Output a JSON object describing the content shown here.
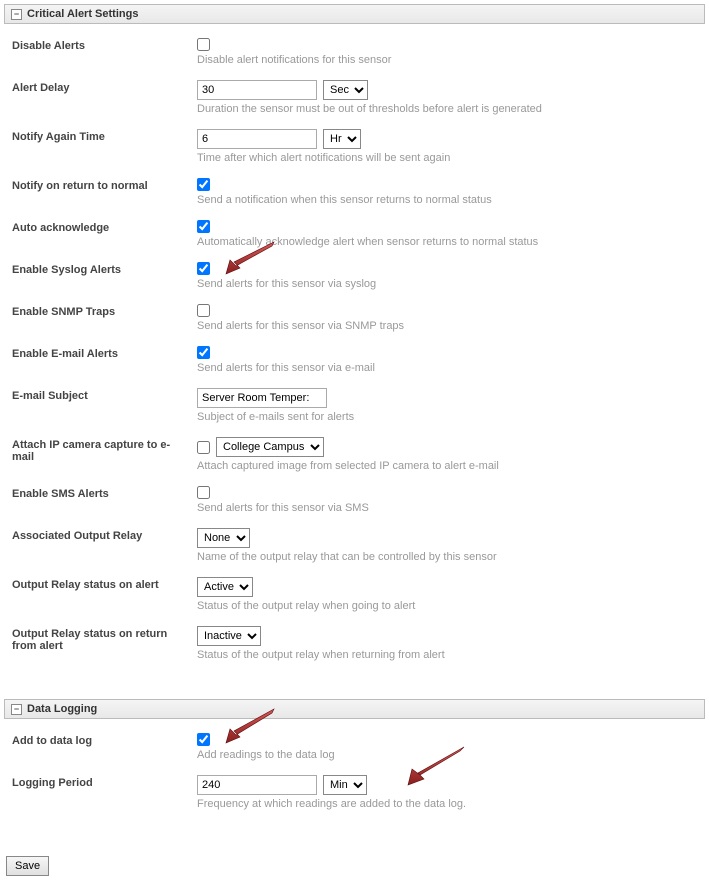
{
  "sections": {
    "critical": {
      "title": "Critical Alert Settings",
      "rows": {
        "disable_alerts": {
          "label": "Disable Alerts",
          "checked": false,
          "help": "Disable alert notifications for this sensor"
        },
        "alert_delay": {
          "label": "Alert Delay",
          "value": "30",
          "unit": "Sec",
          "help": "Duration the sensor must be out of thresholds before alert is generated"
        },
        "notify_again": {
          "label": "Notify Again Time",
          "value": "6",
          "unit": "Hr",
          "help": "Time after which alert notifications will be sent again"
        },
        "notify_return": {
          "label": "Notify on return to normal",
          "checked": true,
          "help": "Send a notification when this sensor returns to normal status"
        },
        "auto_ack": {
          "label": "Auto acknowledge",
          "checked": true,
          "help": "Automatically acknowledge alert when sensor returns to normal status"
        },
        "enable_syslog": {
          "label": "Enable Syslog Alerts",
          "checked": true,
          "help": "Send alerts for this sensor via syslog"
        },
        "enable_snmp": {
          "label": "Enable SNMP Traps",
          "checked": false,
          "help": "Send alerts for this sensor via SNMP traps"
        },
        "enable_email": {
          "label": "Enable E-mail Alerts",
          "checked": true,
          "help": "Send alerts for this sensor via e-mail"
        },
        "email_subject": {
          "label": "E-mail Subject",
          "value": "Server Room Temper:",
          "help": "Subject of e-mails sent for alerts"
        },
        "attach_ip": {
          "label": "Attach IP camera capture to e-mail",
          "checked": false,
          "select": "College Campus",
          "help": "Attach captured image from selected IP camera to alert e-mail"
        },
        "enable_sms": {
          "label": "Enable SMS Alerts",
          "checked": false,
          "help": "Send alerts for this sensor via SMS"
        },
        "assoc_relay": {
          "label": "Associated Output Relay",
          "value": "None",
          "help": "Name of the output relay that can be controlled by this sensor"
        },
        "relay_alert": {
          "label": "Output Relay status on alert",
          "value": "Active",
          "help": "Status of the output relay when going to alert"
        },
        "relay_return": {
          "label": "Output Relay status on return from alert",
          "value": "Inactive",
          "help": "Status of the output relay when returning from alert"
        }
      }
    },
    "logging": {
      "title": "Data Logging",
      "rows": {
        "add_log": {
          "label": "Add to data log",
          "checked": true,
          "help": "Add readings to the data log"
        },
        "log_period": {
          "label": "Logging Period",
          "value": "240",
          "unit": "Min",
          "help": "Frequency at which readings are added to the data log."
        }
      }
    }
  },
  "buttons": {
    "save": "Save"
  }
}
